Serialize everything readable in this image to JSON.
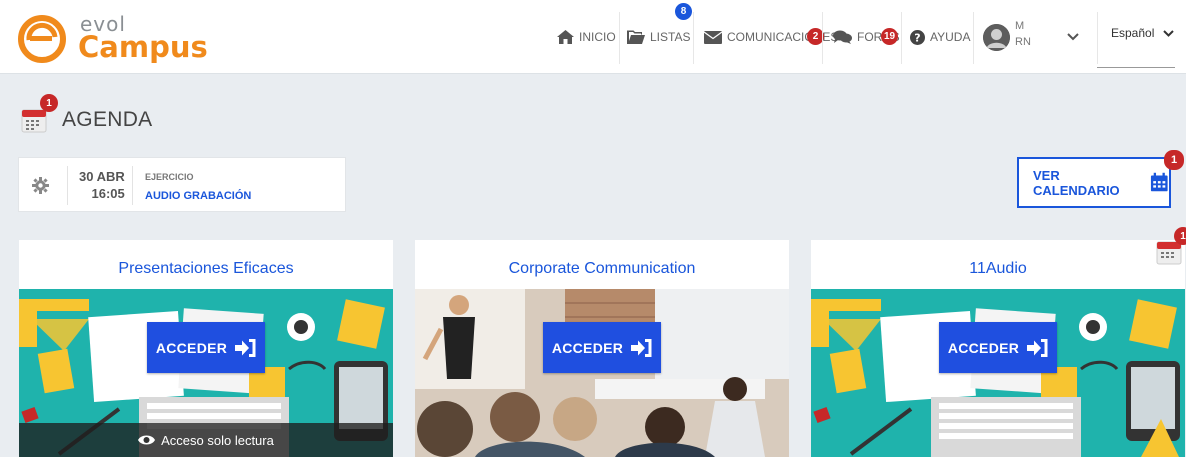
{
  "header": {
    "logo": {
      "top": "evol",
      "bottom": "Campus"
    },
    "nav": [
      {
        "label": "INICIO",
        "icon": "home-icon"
      },
      {
        "label": "LISTAS",
        "icon": "folder-icon",
        "badge": "8"
      },
      {
        "label": "COMUNICACIONES",
        "icon": "envelope-icon",
        "badge": "2"
      },
      {
        "label": "FOROS",
        "icon": "comments-icon",
        "badge": "19"
      },
      {
        "label": "AYUDA",
        "icon": "question-icon"
      }
    ],
    "user": {
      "line1": "M",
      "line2": "RN"
    },
    "language": "Español"
  },
  "agenda": {
    "title": "AGENDA",
    "badge": "1",
    "event": {
      "day": "30 ABR",
      "time": "16:05",
      "type": "EJERCICIO",
      "name": "AUDIO GRABACIÓN"
    },
    "calendar_button": {
      "label": "VER CALENDARIO",
      "badge": "1"
    }
  },
  "courses": [
    {
      "title": "Presentaciones Eficaces",
      "button": "ACCEDER",
      "status": "Acceso solo lectura"
    },
    {
      "title": "Corporate Communication",
      "button": "ACCEDER"
    },
    {
      "title": "11Audio",
      "button": "ACCEDER",
      "calendar_badge": "1"
    }
  ],
  "colors": {
    "accent": "#1a56db",
    "brand_orange": "#f08a1c",
    "badge_red": "#c62828",
    "teal": "#1fb3ac"
  }
}
